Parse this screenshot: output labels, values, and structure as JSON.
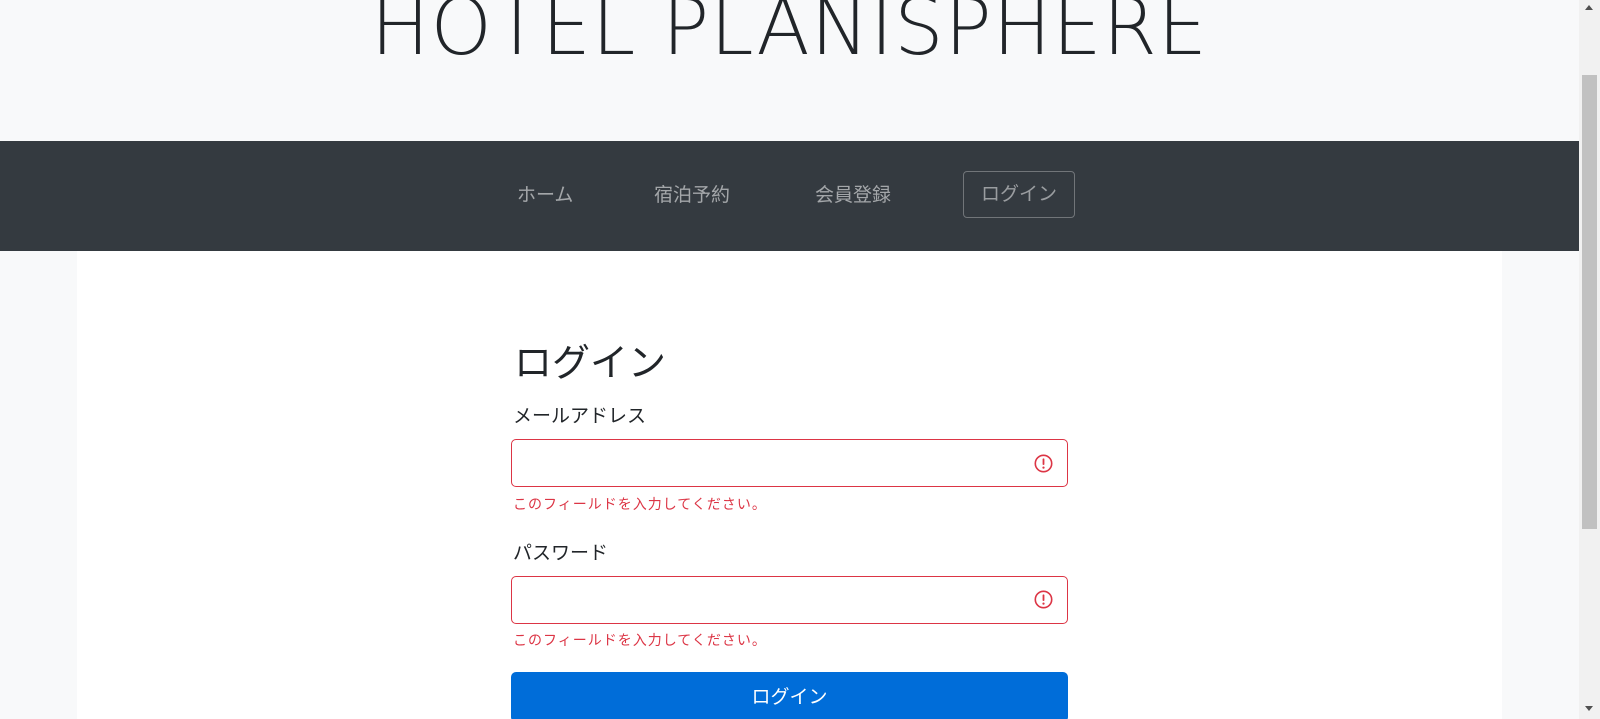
{
  "header": {
    "site_title": "HOTEL PLANISPHERE"
  },
  "nav": {
    "items": [
      {
        "label": "ホーム"
      },
      {
        "label": "宿泊予約"
      },
      {
        "label": "会員登録"
      },
      {
        "label": "ログイン"
      }
    ]
  },
  "login_form": {
    "title": "ログイン",
    "email": {
      "label": "メールアドレス",
      "value": "",
      "error": "このフィールドを入力してください。",
      "status_icon": "exclamation-circle-icon"
    },
    "password": {
      "label": "パスワード",
      "value": "",
      "error": "このフィールドを入力してください。",
      "status_icon": "exclamation-circle-icon"
    },
    "submit_label": "ログイン"
  },
  "colors": {
    "navbar_bg": "#343a40",
    "error": "#dc3545",
    "primary": "#006dd9",
    "page_bg": "#f8f9fa"
  }
}
